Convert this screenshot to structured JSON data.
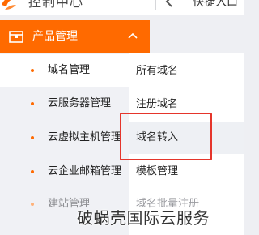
{
  "header": {
    "brand_name": "控制中心",
    "quick_label": "快捷入口",
    "logo_icon": "brand-logo-icon",
    "back_icon": "back-arrow-icon"
  },
  "section": {
    "title": "产品管理",
    "icon": "box-icon",
    "chevron_icon": "chevron-up-icon"
  },
  "nav": {
    "items": [
      {
        "label": "域名管理",
        "active": true
      },
      {
        "label": "云服务器管理"
      },
      {
        "label": "云虚拟主机管理"
      },
      {
        "label": "云企业邮箱管理"
      },
      {
        "label": "建站管理",
        "faded": true
      }
    ]
  },
  "submenu": {
    "items": [
      {
        "label": "所有域名"
      },
      {
        "label": "注册域名"
      },
      {
        "label": "域名转入",
        "highlighted": true
      },
      {
        "label": "模板管理"
      },
      {
        "label": "域名批量注册",
        "faded": true
      }
    ]
  },
  "watermark": {
    "text": "破蜗壳国际云服务"
  },
  "colors": {
    "accent": "#ff6a00",
    "highlight_border": "#e5352b"
  }
}
